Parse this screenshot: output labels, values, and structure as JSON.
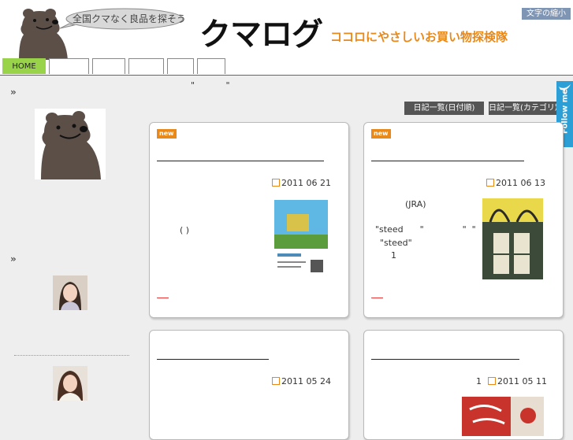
{
  "header": {
    "bubble_text": "全国クマなく良品を探そう",
    "site_title": "クマログ",
    "tagline": "ココロにやさしいお買い物探検隊",
    "font_size_button": "文字の縮小"
  },
  "nav": {
    "home_label": "HOME"
  },
  "marks": "\" \"",
  "side_nav": {
    "chevron1": "»",
    "chevron2": "»"
  },
  "diary": {
    "by_date": "日記一覧(日付順)",
    "by_category": "日記一覧(カテゴリ別)"
  },
  "follow": {
    "label": "Follow me"
  },
  "cards": [
    {
      "badge": "new",
      "date": "2011 06 21",
      "text": "( )"
    },
    {
      "badge": "new",
      "date": "2011 06 13",
      "text_1": "(JRA)",
      "text_2": "\"steed      \"              \"  \"",
      "text_3": "\"steed\"",
      "text_4": "1"
    },
    {
      "date": "2011 05 24"
    },
    {
      "prefix": "1",
      "date": "2011 05 11"
    }
  ],
  "colors": {
    "accent_orange": "#e8891a",
    "nav_home_green": "#99d34a",
    "follow_blue": "#2b9fd6",
    "font_button": "#7f95b4"
  }
}
